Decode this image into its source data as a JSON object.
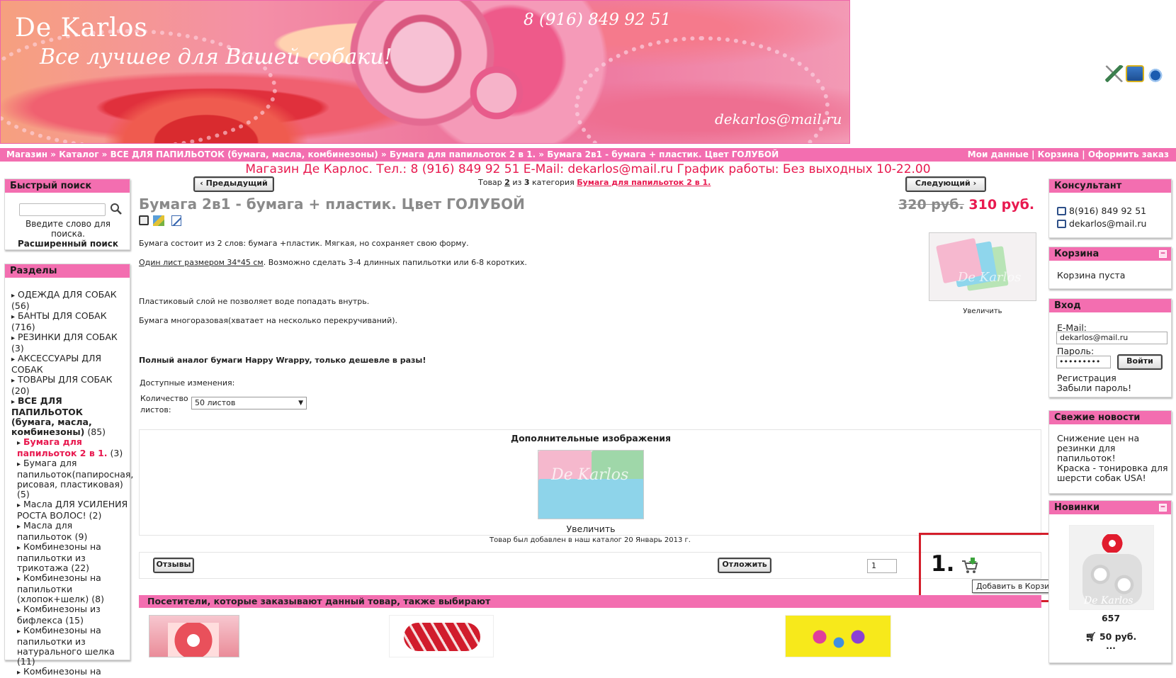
{
  "banner": {
    "logo": "De Karlos",
    "slogan": "Все лучшее для Вашей собаки!",
    "phone": "8 (916) 849 92 51",
    "email": "dekarlos@mail.ru"
  },
  "header_icons": [
    "pen-icon",
    "box-icon",
    "cup-icon"
  ],
  "breadcrumb": {
    "items": [
      "Магазин",
      "Каталог",
      "ВСЕ ДЛЯ ПАПИЛЬОТОК (бумага, масла, комбинезоны)",
      "Бумага для папильоток 2 в 1.",
      "Бумага 2в1 - бумага + пластик. Цвет ГОЛУБОЙ"
    ],
    "separator": "»"
  },
  "top_links": [
    "Мои данные",
    "Корзина",
    "Оформить заказ"
  ],
  "infoline": "Магазин Де Карлос. Тел.: 8 (916) 849 92 51 E-Mail: dekarlos@mail.ru График работы: Без выходных 10-22.00",
  "left": {
    "quick_search": {
      "title": "Быстрый поиск",
      "hint": "Введите слово для поиска.",
      "advanced": "Расширенный поиск"
    },
    "sections": {
      "title": "Разделы",
      "items": [
        {
          "label": "ОДЕЖДА ДЛЯ СОБАК",
          "count": "(56)",
          "level": 0
        },
        {
          "label": "БАНТЫ ДЛЯ СОБАК",
          "count": "(716)",
          "level": 0
        },
        {
          "label": "РЕЗИНКИ ДЛЯ СОБАК",
          "count": "(3)",
          "level": 0
        },
        {
          "label": "АКСЕССУАРЫ ДЛЯ СОБАК",
          "count": "",
          "level": 0
        },
        {
          "label": "ТОВАРЫ ДЛЯ СОБАК",
          "count": "(20)",
          "level": 0
        },
        {
          "label": "ВСЕ ДЛЯ ПАПИЛЬОТОК (бумага, масла, комбинезоны)",
          "count": "(85)",
          "level": 0,
          "bold": true
        },
        {
          "label": "Бумага для папильоток 2 в 1.",
          "count": "(3)",
          "level": 1,
          "active": true
        },
        {
          "label": "Бумага для папильоток(папиросная, рисовая, пластиковая)",
          "count": "(5)",
          "level": 1
        },
        {
          "label": "Масла ДЛЯ УСИЛЕНИЯ РОСТА ВОЛОС!",
          "count": "(2)",
          "level": 1
        },
        {
          "label": "Масла для папильоток",
          "count": "(9)",
          "level": 1
        },
        {
          "label": "Комбинезоны на папильотки из трикотажа",
          "count": "(22)",
          "level": 1
        },
        {
          "label": "Комбинезоны на папильотки (хлопок+шелк)",
          "count": "(8)",
          "level": 1
        },
        {
          "label": "Комбинезоны из бифлекса",
          "count": "(15)",
          "level": 1
        },
        {
          "label": "Комбинезоны на папильотки из натурального шелка",
          "count": "(11)",
          "level": 1
        },
        {
          "label": "Комбинезоны на",
          "count": "",
          "level": 1
        }
      ]
    }
  },
  "product": {
    "prev_label": "Предыдущий",
    "next_label": "Следующий",
    "counter_pre": "Товар",
    "counter_num": "2",
    "counter_mid": "из",
    "counter_total": "3",
    "counter_cat": "категория",
    "category_link": "Бумага для папильоток 2 в 1.",
    "title": "Бумага 2в1 - бумага + пластик. Цвет ГОЛУБОЙ",
    "old_price": "320 руб.",
    "price": "310 руб.",
    "desc1": "Бумага состоит из 2 слов: бумага +пластик. Мягкая, но сохраняет свою форму.",
    "desc2_link": "Один лист размером 34*45 см",
    "desc2_rest": ". Возможно сделать 3-4 длинных папильотки или 6-8 коротких.",
    "desc3": "Пластиковый слой не позволяет воде попадать внутрь.",
    "desc4": "Бумага многоразовая(хватает на несколько перекручиваний).",
    "desc5": "Полный аналог бумаги Happy Wrappy, только дешевле в разы!",
    "enlarge": "Увеличить",
    "watermark": "De Karlos",
    "options_title": "Доступные изменения:",
    "qty_label": "Количество листов:",
    "qty_value": "50 листов",
    "extra_images_title": "Дополнительные изображения",
    "extra_enlarge": "Увеличить",
    "added_note": "Товар был добавлен в наш каталог 20 Январь 2013 г.",
    "reviews_label": "Отзывы",
    "postpone_label": "Отложить",
    "qty_input": "1",
    "annotation": "1.",
    "tooltip": "Добавить в Корзину",
    "also_title": "Посетители, которые заказывают данный товар, также выбирают"
  },
  "right": {
    "consultant": {
      "title": "Консультант",
      "phone": "8(916) 849 92 51",
      "email": "dekarlos@mail.ru"
    },
    "cart": {
      "title": "Корзина",
      "text": "Корзина пуста"
    },
    "login": {
      "title": "Вход",
      "email_label": "E-Mail:",
      "email_value": "dekarlos@mail.ru",
      "pass_label": "Пароль:",
      "pass_value": "•••••••••",
      "login_btn": "Войти",
      "register": "Регистрация",
      "forgot": "Забыли пароль!"
    },
    "news": {
      "title": "Свежие новости",
      "items": [
        "Снижение цен на резинки для папильоток!",
        "Краска - тонировка для шерсти собак USA!"
      ]
    },
    "new_items": {
      "title": "Новинки",
      "code": "657",
      "price": "50 руб.",
      "more": "...",
      "watermark": "De Karlos"
    }
  },
  "colors": {
    "accent_pink": "#f36eb0",
    "price_red": "#e8194f",
    "annotation_red": "#d41e2b"
  }
}
